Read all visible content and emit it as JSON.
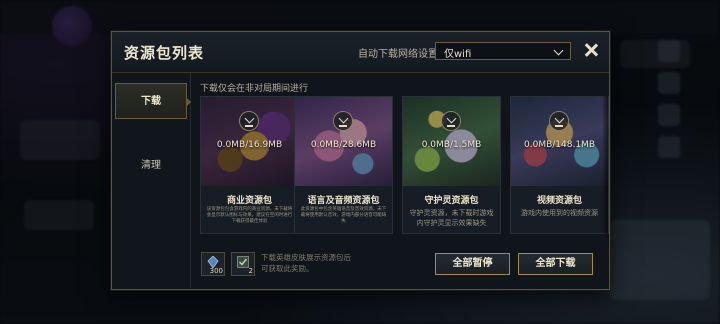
{
  "dialog": {
    "title": "资源包列表",
    "auto_download_label": "自动下载网络设置",
    "network_option": "仅wifi"
  },
  "sidebar": {
    "items": [
      {
        "label": "下载",
        "active": true
      },
      {
        "label": "清理",
        "active": false
      }
    ]
  },
  "content": {
    "hint": "下载仅会在非对局期间进行",
    "packs": [
      {
        "name": "商业资源包",
        "size": "0.0MB/16.9MB",
        "desc": "该资源包包含游戏内的商业资源，未下载将会显示默认图标与效果，建议在空闲时进行下载获得最佳体验"
      },
      {
        "name": "语言及音频资源包",
        "size": "0.0MB/28.6MB",
        "desc": "此资源包中包含英雄语音及音效资源，未下载将使用默认音效，游戏内部分语音可能缺失"
      },
      {
        "name": "守护灵资源包",
        "size": "0.0MB/1.5MB",
        "desc": "守护灵资源，未下载时游戏内守护灵显示效果缺失"
      },
      {
        "name": "视频资源包",
        "size": "0.0MB/148.1MB",
        "desc": "游戏内使用到的视频资源"
      }
    ]
  },
  "bottom": {
    "icons": [
      {
        "name": "skin-count",
        "count": "300"
      },
      {
        "name": "check-count",
        "count": "2"
      }
    ],
    "note": "下载英雄皮肤展示资源包后可获取此奖励。",
    "pause_all_label": "全部暂停",
    "download_all_label": "全部下载"
  },
  "colors": {
    "gold_border": "#a48a4f",
    "panel_bg": "#0f151b",
    "title_text": "#efe6cf"
  }
}
